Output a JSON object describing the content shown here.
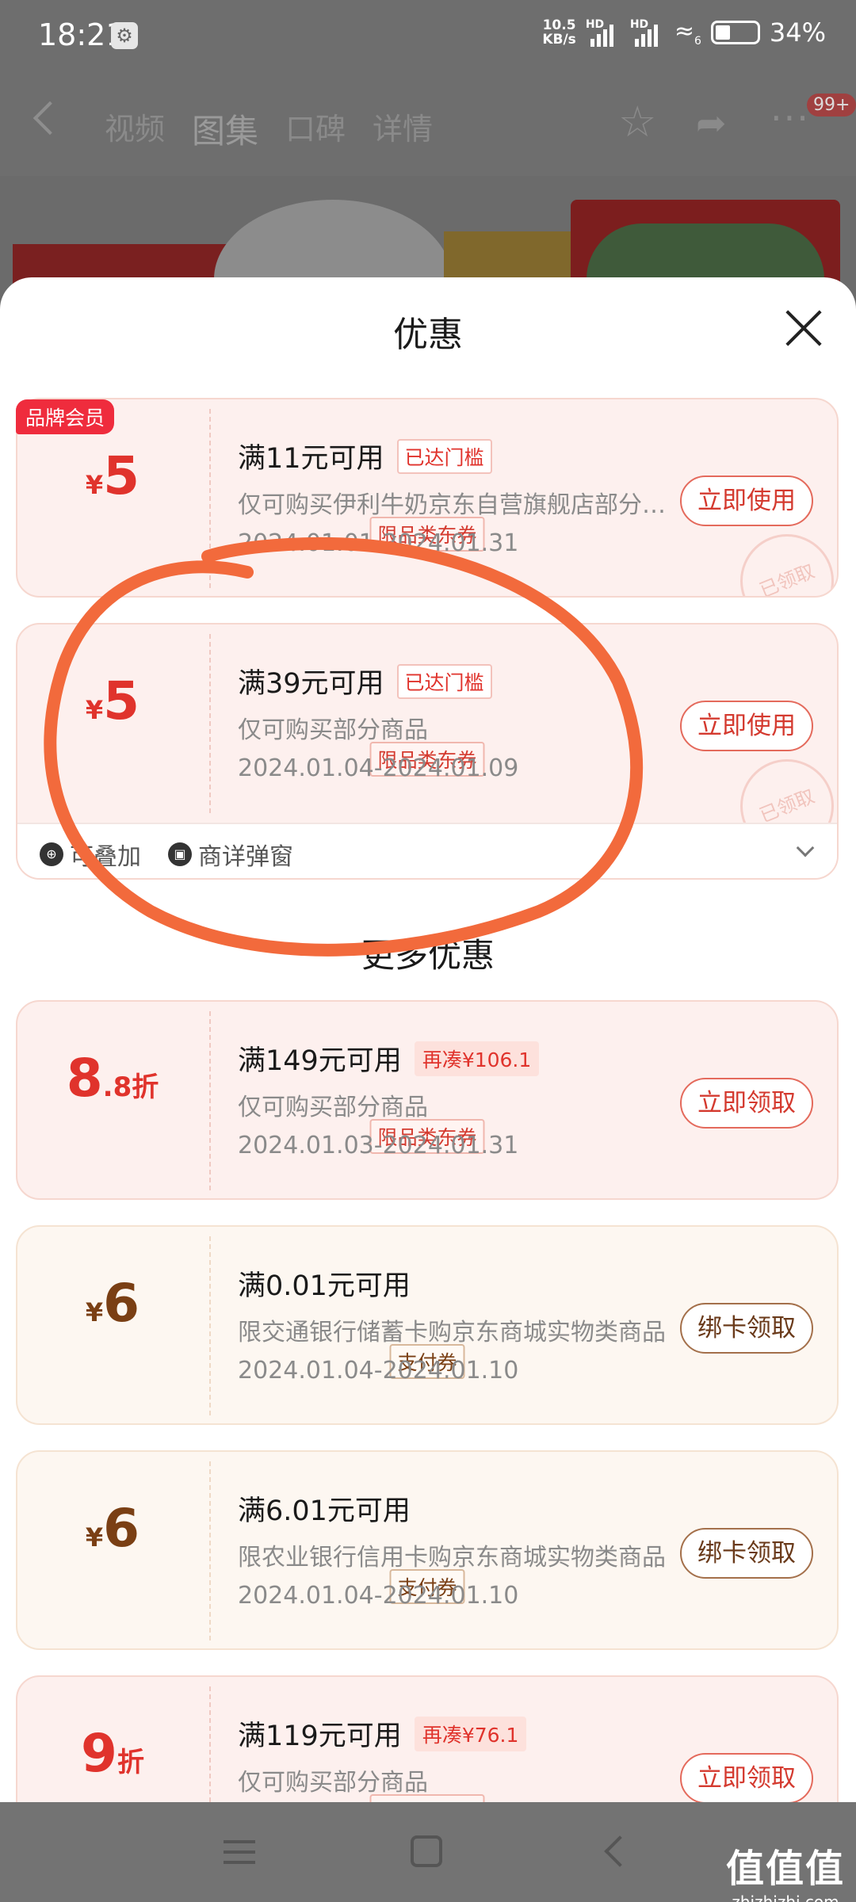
{
  "status_bar": {
    "time": "18:21",
    "speed_value": "10.5",
    "speed_unit": "KB/s",
    "signal1_label": "HD",
    "signal2_label": "HD",
    "wifi_label": "6",
    "battery_percent": "34%"
  },
  "page_nav": {
    "tabs": [
      "视频",
      "图集",
      "口碑",
      "详情"
    ],
    "active_tab": "图集",
    "badge": "99+"
  },
  "sheet": {
    "title": "优惠",
    "section_more_title": "更多优惠",
    "coupons": [
      {
        "brand_badge": "品牌会员",
        "currency": "¥",
        "amount": "5",
        "suffix": "",
        "type": "限品类东券",
        "condition": "满11元可用",
        "tag": "已达门槛",
        "description": "仅可购买伊利牛奶京东自营旗舰店部分商品",
        "date_range": "2024.01.01-2024.01.31",
        "button": "立即使用",
        "stamp": "已领取"
      },
      {
        "currency": "¥",
        "amount": "5",
        "suffix": "",
        "type": "限品类东券",
        "condition": "满39元可用",
        "tag": "已达门槛",
        "description": "仅可购买部分商品",
        "date_range": "2024.01.04-2024.01.09",
        "button": "立即使用",
        "stamp": "已领取",
        "footer_stackable": "可叠加",
        "footer_popup": "商详弹窗"
      },
      {
        "currency": "",
        "amount": "8",
        "suffix": ".8折",
        "type": "限品类东券",
        "condition": "满149元可用",
        "tag": "再凑¥106.1",
        "description": "仅可购买部分商品",
        "date_range": "2024.01.03-2024.01.31",
        "button": "立即领取"
      },
      {
        "currency": "¥",
        "amount": "6",
        "suffix": "",
        "type": "支付券",
        "condition": "满0.01元可用",
        "description": "限交通银行储蓄卡购京东商城实物类商品",
        "date_range": "2024.01.04-2024.01.10",
        "button": "绑卡领取"
      },
      {
        "currency": "¥",
        "amount": "6",
        "suffix": "",
        "type": "支付券",
        "condition": "满6.01元可用",
        "description": "限农业银行信用卡购京东商城实物类商品",
        "date_range": "2024.01.04-2024.01.10",
        "button": "绑卡领取"
      },
      {
        "currency": "",
        "amount": "9",
        "suffix": "折",
        "type": "限品类东券",
        "condition": "满119元可用",
        "tag": "再凑¥76.1",
        "description": "仅可购买部分商品",
        "button": "立即领取"
      }
    ]
  },
  "watermark": {
    "main": "值值值",
    "sub": "zhizhizhi.com"
  },
  "colors": {
    "accent_red": "#e0332c",
    "brown": "#7a3f14",
    "annotation_orange": "#f26a3c"
  }
}
